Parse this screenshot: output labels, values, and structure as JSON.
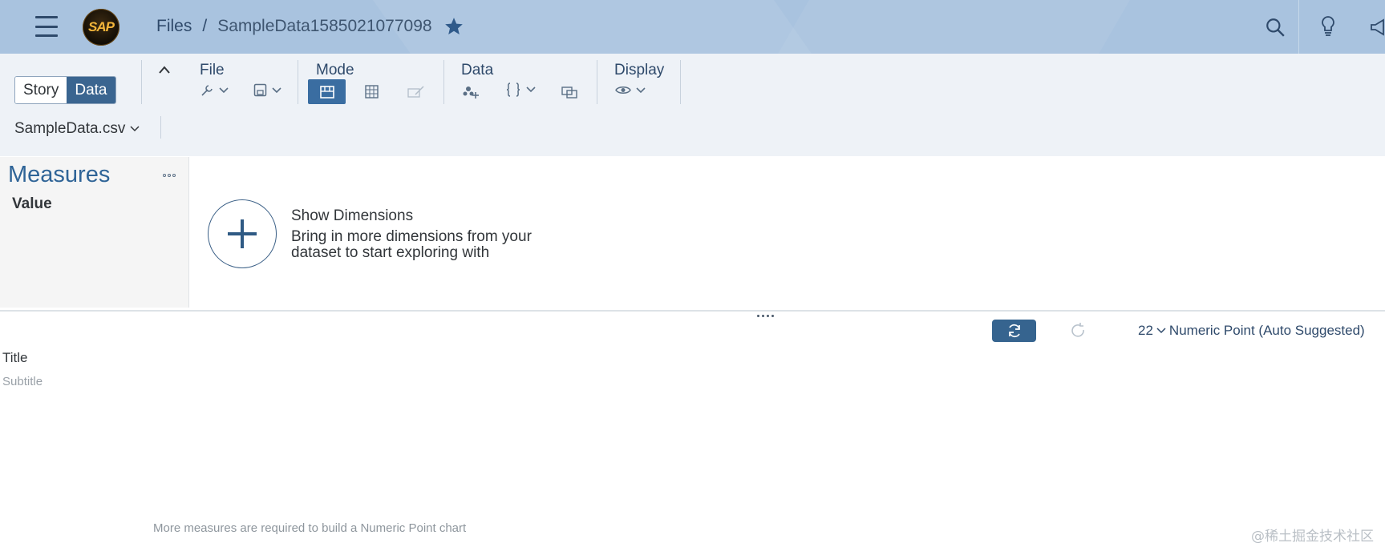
{
  "shell": {
    "logo_text": "SAP",
    "breadcrumb": {
      "root": "Files",
      "separator": "/",
      "document": "SampleData1585021077098"
    },
    "icons": [
      "menu-icon",
      "star-icon",
      "search-icon",
      "lightbulb-icon",
      "megaphone-icon"
    ]
  },
  "toolbar": {
    "view_toggle": {
      "story": "Story",
      "data": "Data",
      "selected": "Data"
    },
    "groups": {
      "file": "File",
      "mode": "Mode",
      "data": "Data",
      "display": "Display"
    },
    "dataset_dropdown": "SampleData.csv"
  },
  "left_panel": {
    "title": "Measures",
    "items": [
      "Value"
    ]
  },
  "show_dimensions": {
    "heading": "Show Dimensions",
    "description": "Bring in more dimensions from your dataset to start exploring with"
  },
  "chart_area": {
    "chart_type_icon_text": "22",
    "chart_type_label": "Numeric Point (Auto Suggested)",
    "title": "Title",
    "subtitle": "Subtitle",
    "message": "More measures are required to build a Numeric Point chart"
  },
  "watermark": "@稀土掘金技术社区",
  "colors": {
    "shell_bg": "#a9c3df",
    "toolbar_bg": "#eef2f7",
    "accent": "#3a6590",
    "measures_title": "#2f6497"
  }
}
